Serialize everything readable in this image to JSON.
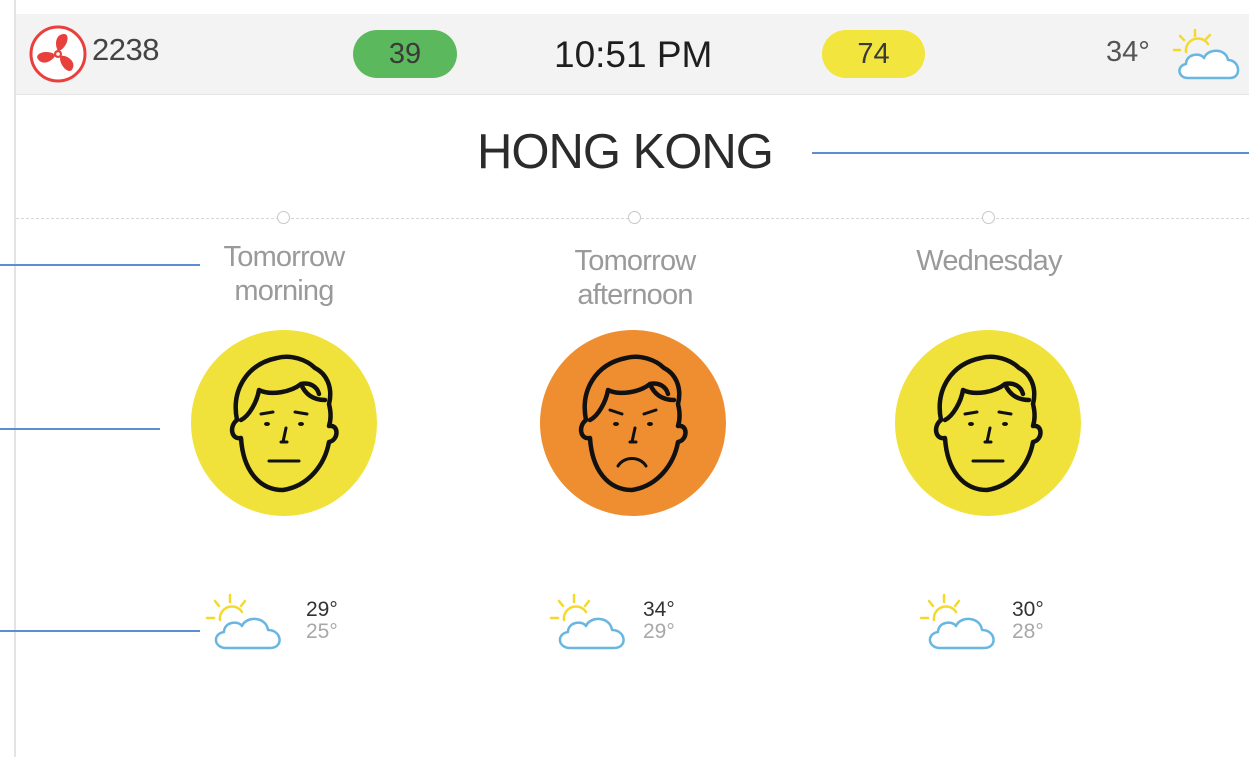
{
  "status_bar": {
    "fan_count": "2238",
    "badge_green": "39",
    "clock": "10:51 PM",
    "badge_yellow": "74",
    "current_temp": "34°",
    "current_weather_icon": "sun-behind-cloud-icon",
    "fan_icon": "fan-icon"
  },
  "city": {
    "name": "HONG KONG"
  },
  "forecasts": [
    {
      "label_line1": "Tomorrow",
      "label_line2": "morning",
      "mood": "neutral",
      "mood_color": "#f0e23a",
      "weather_icon": "sun-behind-cloud-icon",
      "high": "29°",
      "low": "25°"
    },
    {
      "label_line1": "Tomorrow",
      "label_line2": "afternoon",
      "mood": "sad",
      "mood_color": "#ef8e30",
      "weather_icon": "sun-behind-cloud-icon",
      "high": "34°",
      "low": "29°"
    },
    {
      "label_line1": "Wednesday",
      "label_line2": "",
      "mood": "neutral",
      "mood_color": "#f0e23a",
      "weather_icon": "sun-behind-cloud-icon",
      "high": "30°",
      "low": "28°"
    }
  ],
  "colors": {
    "accent_line": "#5b8fd0",
    "good_badge": "#5cb85c",
    "moderate_badge": "#f2e53d",
    "fan_red": "#e8403c",
    "cloud_blue": "#69b7e0",
    "sun_yellow": "#f5d92a"
  }
}
